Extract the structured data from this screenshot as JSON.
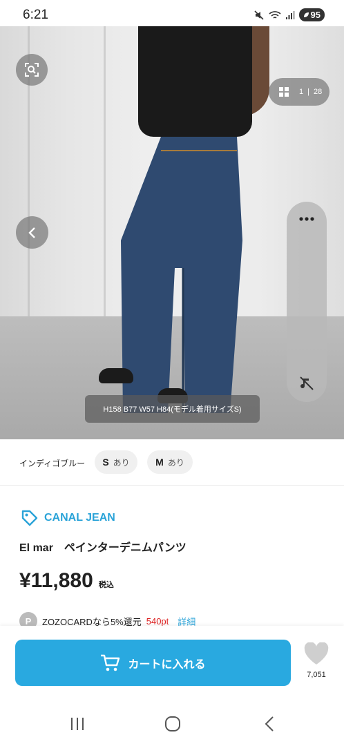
{
  "status_bar": {
    "time": "6:21",
    "battery": "95"
  },
  "gallery": {
    "counter_current": "1",
    "counter_total": "28",
    "model_caption": "H158 B77 W57 H84(モデル着用サイズS)"
  },
  "variant": {
    "color": "インディゴブルー",
    "sizes": [
      {
        "size": "S",
        "availability": "あり"
      },
      {
        "size": "M",
        "availability": "あり"
      }
    ]
  },
  "product": {
    "brand": "CANAL JEAN",
    "name": "El mar　ペインターデニムパンツ",
    "price": "¥11,880",
    "tax_label": "税込",
    "zozocard_initial": "P",
    "zozocard_text": "ZOZOCARDなら5%還元",
    "zozocard_points": "540pt",
    "zozocard_detail": "詳細"
  },
  "actions": {
    "cart_label": "カートに入れる",
    "favorite_count": "7,051"
  },
  "colors": {
    "accent": "#29a9e0",
    "brand_text": "#2aa3d8",
    "points": "#dd2222"
  }
}
